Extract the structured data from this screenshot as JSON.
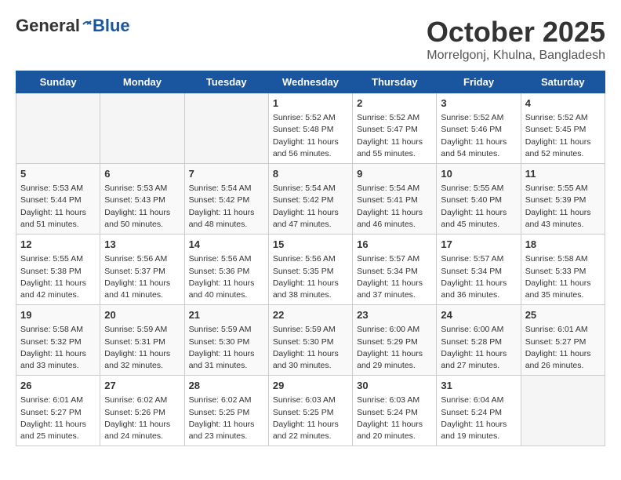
{
  "header": {
    "logo_general": "General",
    "logo_blue": "Blue",
    "month_title": "October 2025",
    "location": "Morrelgonj, Khulna, Bangladesh"
  },
  "days_of_week": [
    "Sunday",
    "Monday",
    "Tuesday",
    "Wednesday",
    "Thursday",
    "Friday",
    "Saturday"
  ],
  "weeks": [
    [
      {
        "day": "",
        "empty": true
      },
      {
        "day": "",
        "empty": true
      },
      {
        "day": "",
        "empty": true
      },
      {
        "day": "1",
        "sunrise": "5:52 AM",
        "sunset": "5:48 PM",
        "daylight": "11 hours and 56 minutes."
      },
      {
        "day": "2",
        "sunrise": "5:52 AM",
        "sunset": "5:47 PM",
        "daylight": "11 hours and 55 minutes."
      },
      {
        "day": "3",
        "sunrise": "5:52 AM",
        "sunset": "5:46 PM",
        "daylight": "11 hours and 54 minutes."
      },
      {
        "day": "4",
        "sunrise": "5:52 AM",
        "sunset": "5:45 PM",
        "daylight": "11 hours and 52 minutes."
      }
    ],
    [
      {
        "day": "5",
        "sunrise": "5:53 AM",
        "sunset": "5:44 PM",
        "daylight": "11 hours and 51 minutes."
      },
      {
        "day": "6",
        "sunrise": "5:53 AM",
        "sunset": "5:43 PM",
        "daylight": "11 hours and 50 minutes."
      },
      {
        "day": "7",
        "sunrise": "5:54 AM",
        "sunset": "5:42 PM",
        "daylight": "11 hours and 48 minutes."
      },
      {
        "day": "8",
        "sunrise": "5:54 AM",
        "sunset": "5:42 PM",
        "daylight": "11 hours and 47 minutes."
      },
      {
        "day": "9",
        "sunrise": "5:54 AM",
        "sunset": "5:41 PM",
        "daylight": "11 hours and 46 minutes."
      },
      {
        "day": "10",
        "sunrise": "5:55 AM",
        "sunset": "5:40 PM",
        "daylight": "11 hours and 45 minutes."
      },
      {
        "day": "11",
        "sunrise": "5:55 AM",
        "sunset": "5:39 PM",
        "daylight": "11 hours and 43 minutes."
      }
    ],
    [
      {
        "day": "12",
        "sunrise": "5:55 AM",
        "sunset": "5:38 PM",
        "daylight": "11 hours and 42 minutes."
      },
      {
        "day": "13",
        "sunrise": "5:56 AM",
        "sunset": "5:37 PM",
        "daylight": "11 hours and 41 minutes."
      },
      {
        "day": "14",
        "sunrise": "5:56 AM",
        "sunset": "5:36 PM",
        "daylight": "11 hours and 40 minutes."
      },
      {
        "day": "15",
        "sunrise": "5:56 AM",
        "sunset": "5:35 PM",
        "daylight": "11 hours and 38 minutes."
      },
      {
        "day": "16",
        "sunrise": "5:57 AM",
        "sunset": "5:34 PM",
        "daylight": "11 hours and 37 minutes."
      },
      {
        "day": "17",
        "sunrise": "5:57 AM",
        "sunset": "5:34 PM",
        "daylight": "11 hours and 36 minutes."
      },
      {
        "day": "18",
        "sunrise": "5:58 AM",
        "sunset": "5:33 PM",
        "daylight": "11 hours and 35 minutes."
      }
    ],
    [
      {
        "day": "19",
        "sunrise": "5:58 AM",
        "sunset": "5:32 PM",
        "daylight": "11 hours and 33 minutes."
      },
      {
        "day": "20",
        "sunrise": "5:59 AM",
        "sunset": "5:31 PM",
        "daylight": "11 hours and 32 minutes."
      },
      {
        "day": "21",
        "sunrise": "5:59 AM",
        "sunset": "5:30 PM",
        "daylight": "11 hours and 31 minutes."
      },
      {
        "day": "22",
        "sunrise": "5:59 AM",
        "sunset": "5:30 PM",
        "daylight": "11 hours and 30 minutes."
      },
      {
        "day": "23",
        "sunrise": "6:00 AM",
        "sunset": "5:29 PM",
        "daylight": "11 hours and 29 minutes."
      },
      {
        "day": "24",
        "sunrise": "6:00 AM",
        "sunset": "5:28 PM",
        "daylight": "11 hours and 27 minutes."
      },
      {
        "day": "25",
        "sunrise": "6:01 AM",
        "sunset": "5:27 PM",
        "daylight": "11 hours and 26 minutes."
      }
    ],
    [
      {
        "day": "26",
        "sunrise": "6:01 AM",
        "sunset": "5:27 PM",
        "daylight": "11 hours and 25 minutes."
      },
      {
        "day": "27",
        "sunrise": "6:02 AM",
        "sunset": "5:26 PM",
        "daylight": "11 hours and 24 minutes."
      },
      {
        "day": "28",
        "sunrise": "6:02 AM",
        "sunset": "5:25 PM",
        "daylight": "11 hours and 23 minutes."
      },
      {
        "day": "29",
        "sunrise": "6:03 AM",
        "sunset": "5:25 PM",
        "daylight": "11 hours and 22 minutes."
      },
      {
        "day": "30",
        "sunrise": "6:03 AM",
        "sunset": "5:24 PM",
        "daylight": "11 hours and 20 minutes."
      },
      {
        "day": "31",
        "sunrise": "6:04 AM",
        "sunset": "5:24 PM",
        "daylight": "11 hours and 19 minutes."
      },
      {
        "day": "",
        "empty": true
      }
    ]
  ],
  "labels": {
    "sunrise": "Sunrise:",
    "sunset": "Sunset:",
    "daylight": "Daylight:"
  }
}
